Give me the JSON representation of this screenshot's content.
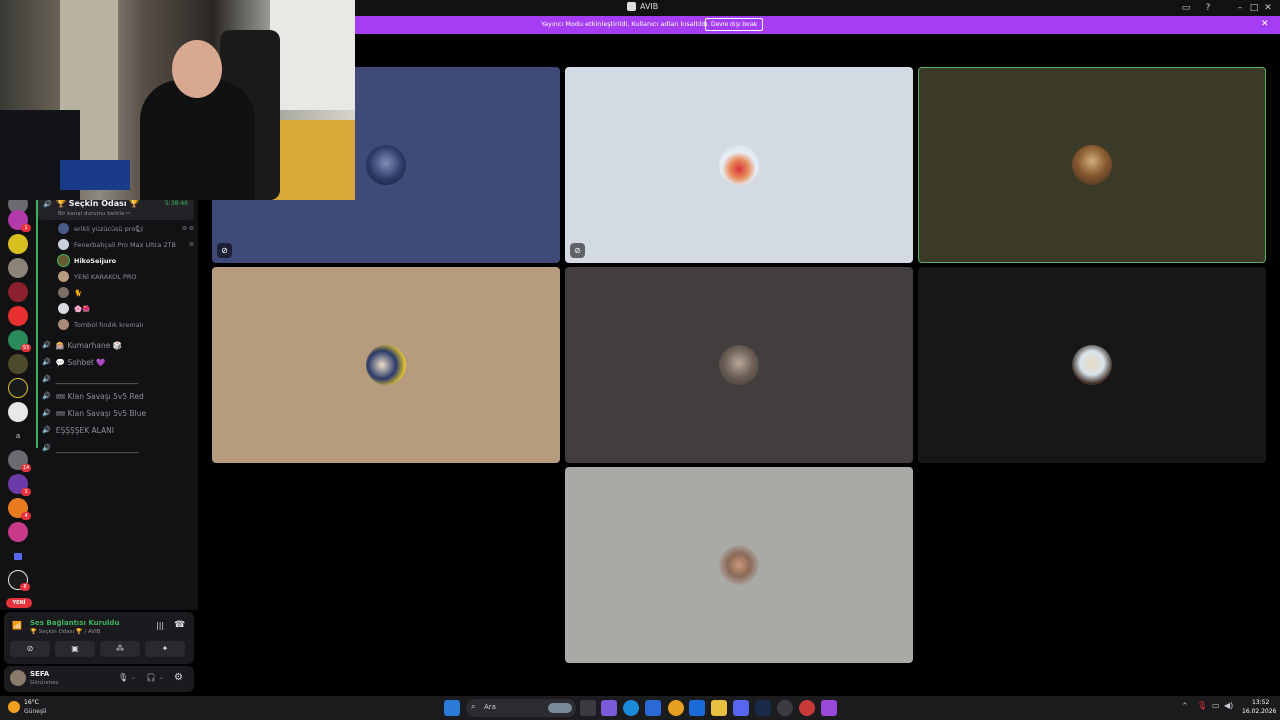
{
  "app": {
    "title": "AVIB"
  },
  "banner": {
    "text": "Yayıncı Modu etkinleştirildi. Kullanıcı adları kısaltıldı.",
    "button": "Devre dışı bırak"
  },
  "rail": {
    "badges": [
      "1",
      "93",
      "14",
      "3",
      "4",
      "8"
    ],
    "new_label": "YENİ"
  },
  "channels": {
    "active": {
      "name": "🏆 Seçkin Odası 🏆",
      "status": "Bir kanal durumu belirle ✏",
      "time": "5:38:46"
    },
    "members": [
      {
        "name": "erikli yüzücüsü pro🐿"
      },
      {
        "name": "Fenerbahçeli Pro Max Ultra 2TB"
      },
      {
        "name": "HikoSeijuro"
      },
      {
        "name": "YENİ KARAKOL PRO"
      },
      {
        "name": "🐈"
      },
      {
        "name": "🌸🌺"
      },
      {
        "name": "Tombol fındık kremalı"
      }
    ],
    "voice_channels": [
      "🎰 Kumarhane 🎲",
      "💬 Sohbet 💜",
      "______________________",
      "🎟 Klan Savaşı 5v5 Red",
      "🎟 Klan Savaşı 5v5 Blue",
      "EŞŞŞŞEK ALANI",
      "______________________"
    ]
  },
  "voice_panel": {
    "status": "Ses Bağlantısı Kuruldu",
    "channel": "🏆 Seçkin Odası 🏆 / AVIB"
  },
  "user_panel": {
    "name": "SEFA",
    "status": "Görünmez"
  },
  "colors": {
    "accent_purple": "#a53ef3",
    "connected_green": "#3bb35d",
    "speaking_outline": "#56b26b"
  },
  "tiles": [
    {
      "bg": "#3f4a78",
      "muted": true
    },
    {
      "bg": "#d3dae4",
      "muted": true
    },
    {
      "bg": "#3a3a26",
      "muted": false,
      "speaking": true
    },
    {
      "bg": "#b69b7f",
      "muted": false
    },
    {
      "bg": "#433e3e",
      "muted": false
    },
    {
      "bg": "#171717",
      "muted": false
    },
    {
      "bg": "#a9aaa6",
      "muted": false
    }
  ],
  "taskbar": {
    "weather_temp": "16°C",
    "weather_desc": "Güneşli",
    "search_label": "Ara",
    "time": "13:52",
    "date": "16.02.2026"
  }
}
